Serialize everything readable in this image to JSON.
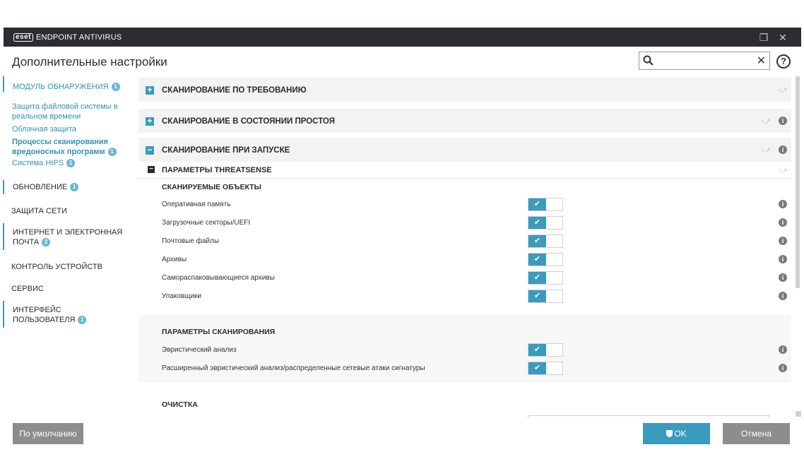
{
  "titlebar": {
    "logo_mark": "eset",
    "product": "ENDPOINT ANTIVIRUS",
    "restore_glyph": "❐",
    "close_glyph": "✕"
  },
  "page_title": "Дополнительные настройки",
  "search": {
    "value": "",
    "placeholder": "",
    "clear_glyph": "✕"
  },
  "help_glyph": "?",
  "sidebar": {
    "detection": {
      "label": "МОДУЛЬ ОБНАРУЖЕНИЯ",
      "badge": "1",
      "items": [
        {
          "label": "Защита файловой системы в реальном времени"
        },
        {
          "label": "Облачная защита"
        },
        {
          "label": "Процессы сканирования вредоносных программ",
          "badge": "1"
        },
        {
          "label": "Система HIPS",
          "badge": "1"
        }
      ]
    },
    "update": {
      "label": "ОБНОВЛЕНИЕ",
      "badge": "1"
    },
    "network": {
      "label": "ЗАЩИТА СЕТИ"
    },
    "web": {
      "label": "ИНТЕРНЕТ И ЭЛЕКТРОННАЯ ПОЧТА",
      "badge": "2"
    },
    "devices": {
      "label": "КОНТРОЛЬ УСТРОЙСТВ"
    },
    "tools": {
      "label": "СЕРВИС"
    },
    "ui": {
      "label": "ИНТЕРФЕЙС ПОЛЬЗОВАТЕЛЯ",
      "badge": "1"
    }
  },
  "sections": {
    "ondemand": {
      "label": "СКАНИРОВАНИЕ ПО ТРЕБОВАНИЮ",
      "toggle": "+"
    },
    "idle": {
      "label": "СКАНИРОВАНИЕ В СОСТОЯНИИ ПРОСТОЯ",
      "toggle": "+"
    },
    "startup": {
      "label": "СКАНИРОВАНИЕ ПРИ ЗАПУСКЕ",
      "toggle": "−"
    },
    "threatsense": {
      "label": "ПАРАМЕТРЫ THREATSENSE",
      "toggle": "−"
    }
  },
  "revert_glyph": "⤻",
  "info_glyph": "i",
  "check_glyph": "✔",
  "scan_objects": {
    "title": "СКАНИРУЕМЫЕ ОБЪЕКТЫ",
    "rows": [
      {
        "label": "Оперативная память",
        "enabled": true
      },
      {
        "label": "Загрузочные секторы/UEFI",
        "enabled": true
      },
      {
        "label": "Почтовые файлы",
        "enabled": true
      },
      {
        "label": "Архивы",
        "enabled": true
      },
      {
        "label": "Самораспаковывающиеся архивы",
        "enabled": true
      },
      {
        "label": "Упаковщики",
        "enabled": true
      }
    ]
  },
  "scan_params": {
    "title": "ПАРАМЕТРЫ СКАНИРОВАНИЯ",
    "rows": [
      {
        "label": "Эвристический анализ",
        "enabled": true
      },
      {
        "label": "Расширенный эвристический анализ/распределенные сетевые атаки сигнатуры",
        "enabled": true
      }
    ]
  },
  "cleaning": {
    "title": "ОЧИСТКА"
  },
  "footer": {
    "default_label": "По умолчанию",
    "ok_label": "OK",
    "cancel_label": "Отмена"
  },
  "colors": {
    "accent": "#3a9bbf",
    "titlebar": "#2b2d30",
    "button_gray": "#8d8d8d"
  }
}
